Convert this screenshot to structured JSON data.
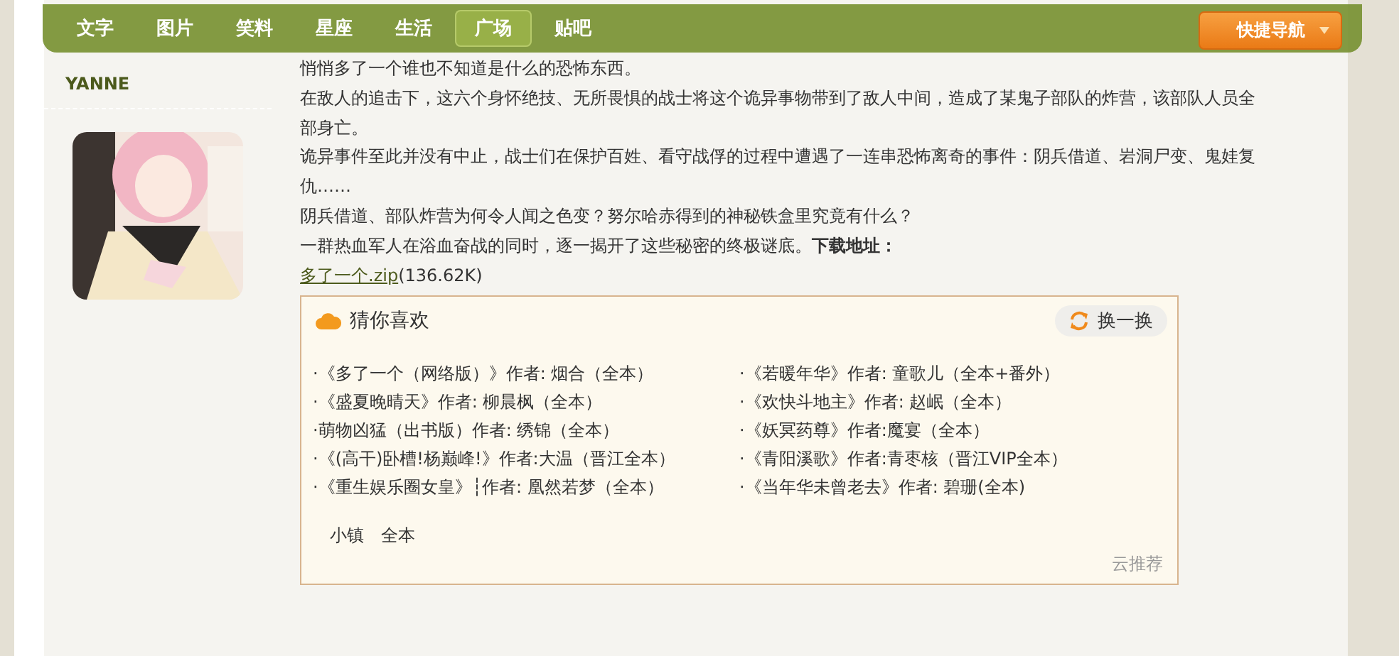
{
  "nav": {
    "items": [
      {
        "label": "文字",
        "selected": false
      },
      {
        "label": "图片",
        "selected": false
      },
      {
        "label": "笑料",
        "selected": false
      },
      {
        "label": "星座",
        "selected": false
      },
      {
        "label": "生活",
        "selected": false
      },
      {
        "label": "广场",
        "selected": true
      },
      {
        "label": "贴吧",
        "selected": false
      }
    ],
    "quick_nav": "快捷导航"
  },
  "sidebar": {
    "username": "YANNE"
  },
  "post": {
    "paragraphs": [
      "悄悄多了一个谁也不知道是什么的恐怖东西。",
      "在敌人的追击下，这六个身怀绝技、无所畏惧的战士将这个诡异事物带到了敌人中间，造成了某鬼子部队的炸营，该部队人员全部身亡。",
      "诡异事件至此并没有中止，战士们在保护百姓、看守战俘的过程中遭遇了一连串恐怖离奇的事件：阴兵借道、岩洞尸变、鬼娃复仇……",
      "阴兵借道、部队炸营为何令人闻之色变？努尔哈赤得到的神秘铁盒里究竟有什么？",
      "一群热血军人在浴血奋战的同时，逐一揭开了这些秘密的终极谜底。**下载地址：**"
    ],
    "attachment": {
      "name": "多了一个.zip",
      "size": "(136.62K)"
    }
  },
  "recommend": {
    "title": "猜你喜欢",
    "refresh": "换一换",
    "items": [
      "·《多了一个（网络版）》作者: 烟合（全本）",
      "·《若暖年华》作者: 童歌儿（全本+番外）",
      "·《盛夏晚晴天》作者: 柳晨枫（全本）",
      "·《欢快斗地主》作者: 赵岷（全本）",
      "·萌物凶猛（出书版）作者: 绣锦（全本）",
      "·《妖冥药尊》作者:魔宴（全本）",
      "·《(高干)卧槽!杨巅峰!》作者:大温（晋江全本）",
      "·《青阳溪歌》作者:青枣核（晋江VIP全本）",
      "·《重生娱乐圈女皇》┆作者: 凰然若梦（全本）",
      "·《当年华未曾老去》作者: 碧珊(全本)"
    ],
    "tags": [
      "小镇",
      "全本"
    ],
    "footer": "云推荐"
  }
}
